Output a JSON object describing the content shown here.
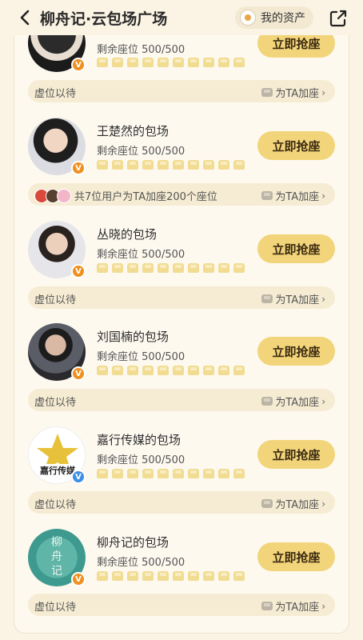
{
  "header": {
    "title": "柳舟记·云包场广场",
    "assets_label": "我的资产"
  },
  "seat_icon_count": 10,
  "cards": [
    {
      "name": "",
      "seats_label": "剩余座位 500/500",
      "grab_label": "立即抢座",
      "support_text": "虚位以待",
      "support_action": "为TA加座",
      "badge": "orange"
    },
    {
      "name": "王楚然的包场",
      "seats_label": "剩余座位 500/500",
      "grab_label": "立即抢座",
      "support_text": "共7位用户为TA加座200个座位",
      "support_action": "为TA加座",
      "badge": "orange"
    },
    {
      "name": "丛晓的包场",
      "seats_label": "剩余座位 500/500",
      "grab_label": "立即抢座",
      "support_text": "虚位以待",
      "support_action": "为TA加座",
      "badge": "orange"
    },
    {
      "name": "刘国楠的包场",
      "seats_label": "剩余座位 500/500",
      "grab_label": "立即抢座",
      "support_text": "虚位以待",
      "support_action": "为TA加座",
      "badge": "orange"
    },
    {
      "name": "嘉行传媒的包场",
      "seats_label": "剩余座位 500/500",
      "grab_label": "立即抢座",
      "support_text": "虚位以待",
      "support_action": "为TA加座",
      "badge": "blue",
      "logo_text": "嘉行传媒"
    },
    {
      "name": "柳舟记的包场",
      "seats_label": "剩余座位 500/500",
      "grab_label": "立即抢座",
      "support_text": "虚位以待",
      "support_action": "为TA加座",
      "badge": "orange",
      "logo_text": "柳舟记"
    }
  ],
  "colors": {
    "background": "#fbf4e4",
    "grab_button": "#f2d47a",
    "seat": "#f1dc92",
    "v_badge": "#f0901e",
    "v_badge_blue": "#3d8fe6"
  }
}
